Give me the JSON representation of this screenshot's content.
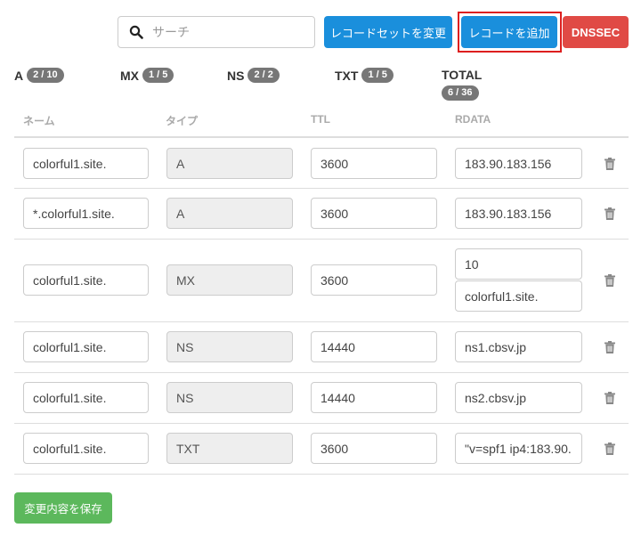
{
  "search": {
    "placeholder": "サーチ"
  },
  "toolbar": {
    "change_recordset_label": "レコードセットを変更",
    "add_record_label": "レコードを追加",
    "dnssec_label": "DNSSEC"
  },
  "stats": [
    {
      "label": "A",
      "count": "2 / 10"
    },
    {
      "label": "MX",
      "count": "1 / 5"
    },
    {
      "label": "NS",
      "count": "2 / 2"
    },
    {
      "label": "TXT",
      "count": "1 / 5"
    },
    {
      "label": "TOTAL",
      "count": "6 / 36"
    }
  ],
  "table": {
    "headers": [
      "ネーム",
      "タイプ",
      "TTL",
      "RDATA"
    ],
    "rows": [
      {
        "name": "colorful1.site.",
        "type": "A",
        "ttl": "3600",
        "rdata": [
          "183.90.183.156"
        ]
      },
      {
        "name": "*.colorful1.site.",
        "type": "A",
        "ttl": "3600",
        "rdata": [
          "183.90.183.156"
        ]
      },
      {
        "name": "colorful1.site.",
        "type": "MX",
        "ttl": "3600",
        "rdata": [
          "10",
          "colorful1.site."
        ]
      },
      {
        "name": "colorful1.site.",
        "type": "NS",
        "ttl": "14440",
        "rdata": [
          "ns1.cbsv.jp"
        ]
      },
      {
        "name": "colorful1.site.",
        "type": "NS",
        "ttl": "14440",
        "rdata": [
          "ns2.cbsv.jp"
        ]
      },
      {
        "name": "colorful1.site.",
        "type": "TXT",
        "ttl": "3600",
        "rdata": [
          "\"v=spf1 ip4:183.90."
        ]
      }
    ]
  },
  "footer": {
    "save_label": "変更内容を保存"
  },
  "icons": {
    "search": "search-icon",
    "delete": "trash-icon"
  },
  "colors": {
    "primary": "#1a8fdc",
    "danger": "#e04a45",
    "success": "#5cb85c",
    "badge": "#777777",
    "highlight": "#dd1f1f"
  }
}
